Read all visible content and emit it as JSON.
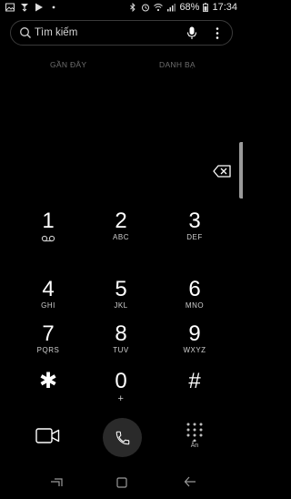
{
  "status_bar": {
    "battery": "68%",
    "time": "17:34",
    "left_icons": [
      "gallery-icon",
      "download-icon",
      "play-store-icon",
      "more-notifications-icon"
    ],
    "right_icons": [
      "bluetooth-icon",
      "alarm-icon",
      "wifi-icon",
      "signal-icon",
      "battery-icon"
    ]
  },
  "search": {
    "placeholder": "Tìm kiếm"
  },
  "tabs": [
    {
      "label": "GẦN ĐÂY"
    },
    {
      "label": "DANH BẠ"
    }
  ],
  "keypad": [
    {
      "digit": "1",
      "letters": "",
      "letter_icon": "voicemail-icon"
    },
    {
      "digit": "2",
      "letters": "ABC"
    },
    {
      "digit": "3",
      "letters": "DEF"
    },
    {
      "digit": "4",
      "letters": "GHI"
    },
    {
      "digit": "5",
      "letters": "JKL"
    },
    {
      "digit": "6",
      "letters": "MNO"
    },
    {
      "digit": "7",
      "letters": "PQRS"
    },
    {
      "digit": "8",
      "letters": "TUV"
    },
    {
      "digit": "9",
      "letters": "WXYZ"
    },
    {
      "digit": "✱",
      "letters": ""
    },
    {
      "digit": "0",
      "letters": "+"
    },
    {
      "digit": "#",
      "letters": ""
    }
  ],
  "actions": {
    "hide_label": "Ẩn"
  },
  "colors": {
    "background": "#000000",
    "text": "#ffffff",
    "tab_text": "#6e6e6e",
    "call_button": "#2a2a2a"
  }
}
